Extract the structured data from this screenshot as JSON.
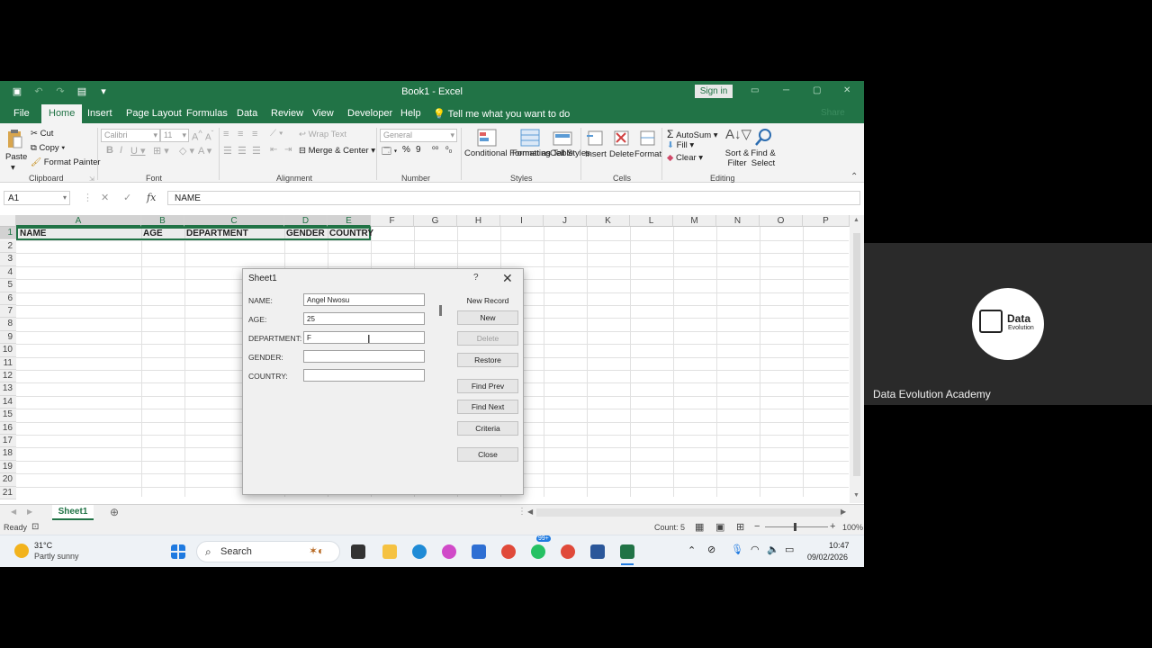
{
  "window": {
    "title": "Book1 - Excel",
    "signin": "Sign in",
    "share": "Share"
  },
  "menu": {
    "tabs": [
      "File",
      "Home",
      "Insert",
      "Page Layout",
      "Formulas",
      "Data",
      "Review",
      "View",
      "Developer",
      "Help"
    ],
    "tellme": "Tell me what you want to do"
  },
  "ribbon": {
    "clipboard": {
      "paste": "Paste",
      "cut": "Cut",
      "copy": "Copy",
      "format_painter": "Format Painter",
      "label": "Clipboard"
    },
    "font": {
      "name": "Calibri",
      "size": "11",
      "label": "Font"
    },
    "alignment": {
      "wrap": "Wrap Text",
      "merge": "Merge & Center",
      "label": "Alignment"
    },
    "number": {
      "format": "General",
      "label": "Number"
    },
    "styles": {
      "conditional": "Conditional Formatting",
      "format_table": "Format as Table",
      "cell_styles": "Cell Styles",
      "label": "Styles"
    },
    "cells": {
      "insert": "Insert",
      "delete": "Delete",
      "format": "Format",
      "label": "Cells"
    },
    "editing": {
      "autosum": "AutoSum",
      "fill": "Fill",
      "clear": "Clear",
      "sort": "Sort & Filter",
      "find": "Find & Select",
      "label": "Editing"
    }
  },
  "formula": {
    "namebox": "A1",
    "value": "NAME"
  },
  "grid": {
    "columns": [
      "A",
      "B",
      "C",
      "D",
      "E",
      "F",
      "G",
      "H",
      "I",
      "J",
      "K",
      "L",
      "M",
      "N",
      "O",
      "P"
    ],
    "rows": [
      "1",
      "2",
      "3",
      "4",
      "5",
      "6",
      "7",
      "8",
      "9",
      "10",
      "11",
      "12",
      "13",
      "14",
      "15",
      "16",
      "17",
      "18",
      "19",
      "20",
      "21"
    ],
    "headers": [
      "NAME",
      "AGE",
      "DEPARTMENT",
      "GENDER",
      "COUNTRY"
    ]
  },
  "sheet": {
    "tab": "Sheet1"
  },
  "status": {
    "ready": "Ready",
    "count": "Count: 5",
    "zoom": "100%"
  },
  "dialog": {
    "title": "Sheet1",
    "help": "?",
    "record_label": "New Record",
    "fields": [
      {
        "label": "NAME:",
        "value": "Angel Nwosu"
      },
      {
        "label": "AGE:",
        "value": "25"
      },
      {
        "label": "DEPARTMENT:",
        "value": "F"
      },
      {
        "label": "GENDER:",
        "value": ""
      },
      {
        "label": "COUNTRY:",
        "value": ""
      }
    ],
    "buttons": {
      "new": "New",
      "delete": "Delete",
      "restore": "Restore",
      "find_prev": "Find Prev",
      "find_next": "Find Next",
      "criteria": "Criteria",
      "close": "Close"
    }
  },
  "taskbar": {
    "temp": "31°C",
    "weather": "Partly sunny",
    "search": "Search",
    "badge": "99+",
    "time": "10:47",
    "date": "09/02/2026"
  },
  "panel": {
    "logo_line1": "Data",
    "logo_line2": "Evolution",
    "name": "Data Evolution Academy"
  }
}
